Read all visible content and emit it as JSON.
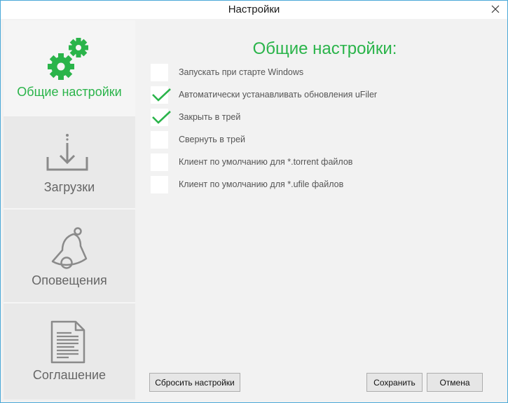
{
  "window": {
    "title": "Настройки"
  },
  "sidebar": {
    "items": [
      {
        "label": "Общие настройки",
        "icon": "gears-icon",
        "active": true
      },
      {
        "label": "Загрузки",
        "icon": "download-icon",
        "active": false
      },
      {
        "label": "Оповещения",
        "icon": "bell-icon",
        "active": false
      },
      {
        "label": "Соглашение",
        "icon": "document-icon",
        "active": false
      }
    ]
  },
  "main": {
    "heading": "Общие настройки:",
    "options": [
      {
        "label": "Запускать при старте Windows",
        "checked": false
      },
      {
        "label": "Автоматически устанавливать обновления uFiler",
        "checked": true
      },
      {
        "label": "Закрыть в трей",
        "checked": true
      },
      {
        "label": "Свернуть в трей",
        "checked": false
      },
      {
        "label": "Клиент по умолчанию для *.torrent файлов",
        "checked": false
      },
      {
        "label": "Клиент по умолчанию для *.ufile файлов",
        "checked": false
      }
    ]
  },
  "buttons": {
    "reset": "Сбросить настройки",
    "save": "Сохранить",
    "cancel": "Отмена"
  },
  "colors": {
    "accent": "#2ab44a",
    "text_muted": "#666666",
    "border": "#4aa8d8"
  }
}
